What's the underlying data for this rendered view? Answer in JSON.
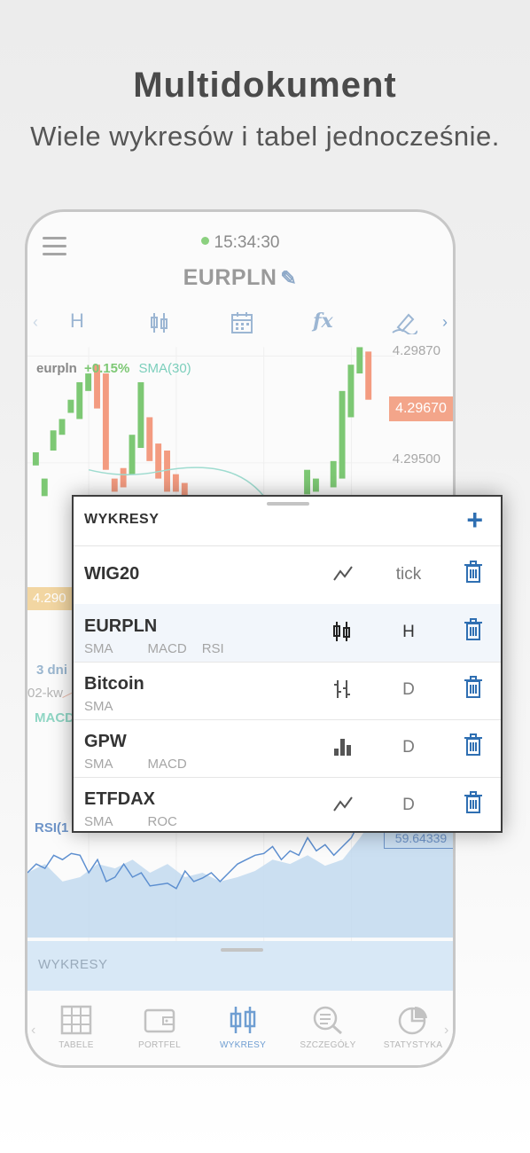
{
  "hero": {
    "title": "Multidokument",
    "subtitle": "Wiele wykresów i tabel jednocześnie."
  },
  "phone": {
    "time": "15:34:30",
    "symbol": "EURPLN",
    "toolbar": {
      "interval": "H"
    },
    "chart": {
      "instrument": "eurpln",
      "change": "+0.15%",
      "indicator": "SMA(30)",
      "price_labels": [
        "4.29870",
        "4.29500"
      ],
      "last_price": "4.29670",
      "left_tag": "4.290",
      "range_label": "3 dni",
      "date_label": "02-kw",
      "macd_label": "MACD",
      "rsi_label": "RSI(1",
      "rsi_value": "59.64339"
    },
    "panel_label": "WYKRESY",
    "nav": [
      {
        "label": "TABELE",
        "icon": "table-icon"
      },
      {
        "label": "PORTFEL",
        "icon": "wallet-icon"
      },
      {
        "label": "WYKRESY",
        "icon": "candlestick-icon",
        "active": true
      },
      {
        "label": "SZCZEGÓŁY",
        "icon": "search-details-icon"
      },
      {
        "label": "STATYSTYKA",
        "icon": "pie-chart-icon"
      }
    ]
  },
  "popup": {
    "title": "WYKRESY",
    "charts": [
      {
        "name": "WIG20",
        "indicators": [],
        "chart_type": "line",
        "interval": "tick"
      },
      {
        "name": "EURPLN",
        "indicators": [
          "SMA",
          "MACD",
          "RSI"
        ],
        "chart_type": "candlestick",
        "interval": "H",
        "selected": true
      },
      {
        "name": "Bitcoin",
        "indicators": [
          "SMA"
        ],
        "chart_type": "ohlc",
        "interval": "D"
      },
      {
        "name": "GPW",
        "indicators": [
          "SMA",
          "MACD"
        ],
        "chart_type": "bar",
        "interval": "D"
      },
      {
        "name": "ETFDAX",
        "indicators": [
          "SMA",
          "ROC"
        ],
        "chart_type": "line",
        "interval": "D"
      }
    ]
  },
  "colors": {
    "accent": "#2f6fb2",
    "up_candle": "#7dc874",
    "down_candle": "#f39b80",
    "nav_active": "#6f9ed2"
  }
}
